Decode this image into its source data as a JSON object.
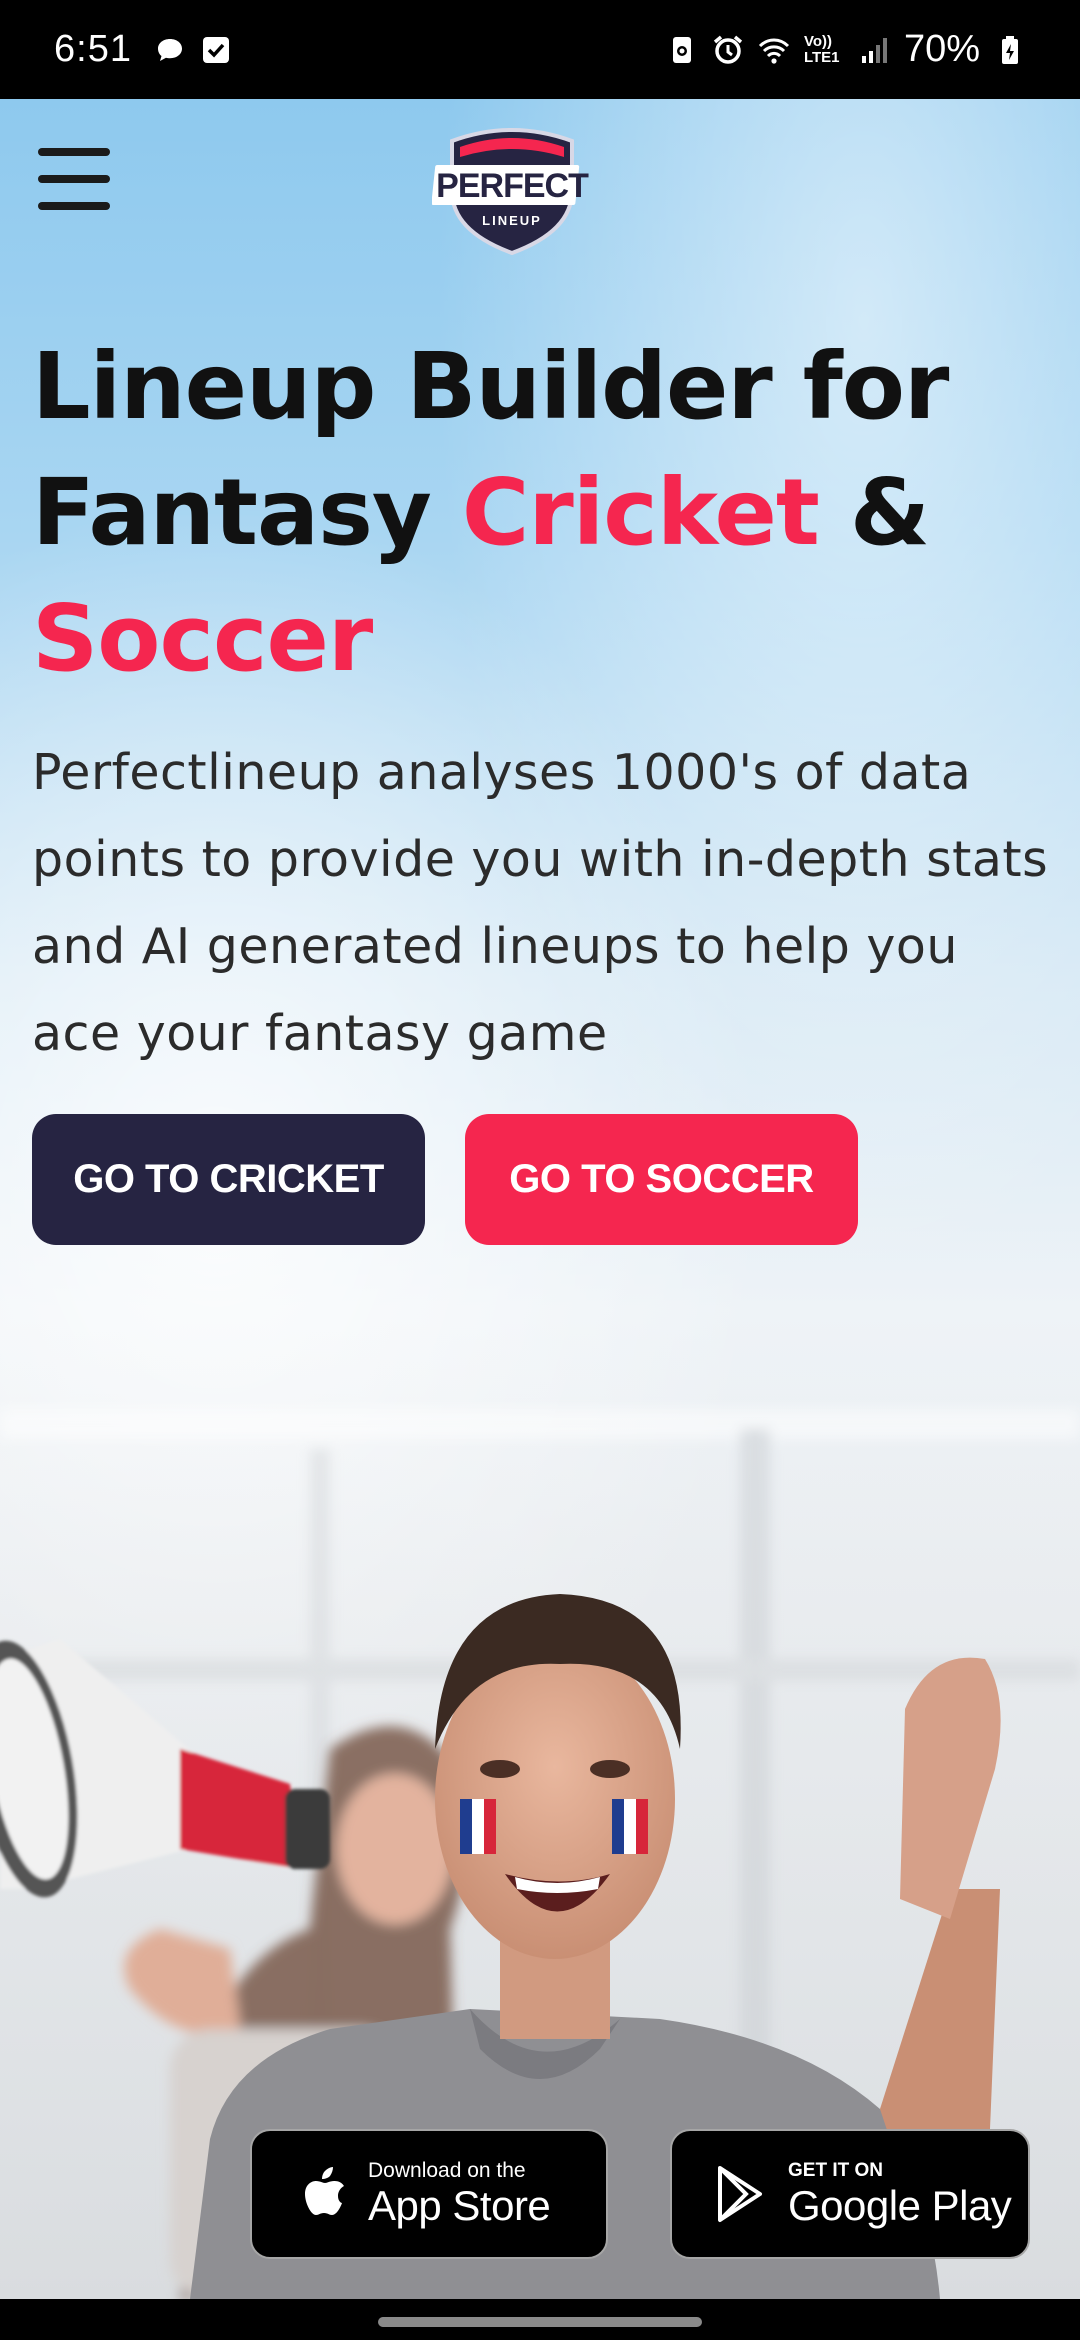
{
  "status_bar": {
    "time": "6:51",
    "battery": "70%",
    "network_label": "Vo)) LTE1",
    "icons": [
      "chat-icon",
      "checkbox-icon",
      "nfc-icon",
      "alarm-icon",
      "wifi-icon",
      "signal-icon",
      "battery-icon"
    ]
  },
  "header": {
    "menu_icon": "hamburger-menu-icon",
    "logo": {
      "line1": "PERFECT",
      "line2": "LINEUP"
    }
  },
  "hero": {
    "title_part1": "Lineup Builder for",
    "title_part2": "Fantasy ",
    "title_accent1": "Cricket",
    "title_part3": " &",
    "title_accent2": "Soccer",
    "description": "Perfectlineup analyses 1000's of data points to provide you with in-depth stats and AI generated lineups to help you ace your fantasy game"
  },
  "buttons": {
    "cricket": "GO TO CRICKET",
    "soccer": "GO TO SOCCER"
  },
  "store_badges": {
    "app_store": {
      "small": "Download on the",
      "big": "App Store",
      "icon": "apple-icon"
    },
    "google_play": {
      "small": "GET IT ON",
      "big": "Google Play",
      "icon": "google-play-icon"
    }
  },
  "colors": {
    "accent": "#f5264f",
    "dark_button": "#262442",
    "title_text": "#111111"
  }
}
